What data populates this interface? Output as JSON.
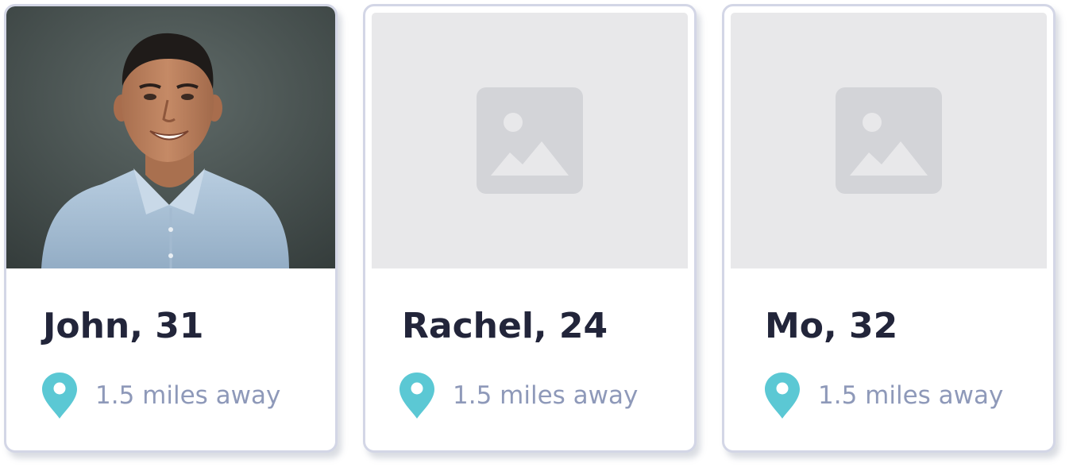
{
  "colors": {
    "accent_pin": "#5bc8d4",
    "name_text": "#22253a",
    "distance_text": "#8e99b9",
    "card_border": "#d3d6e6",
    "placeholder_bg": "#e8e8ea",
    "placeholder_icon": "#d3d4d8"
  },
  "profiles": [
    {
      "name_age": "John, 31",
      "distance": "1.5 miles away",
      "photo": "portrait-photo",
      "icon": "location-pin-icon"
    },
    {
      "name_age": "Rachel, 24",
      "distance": "1.5 miles away",
      "photo": "image-placeholder-icon",
      "icon": "location-pin-icon"
    },
    {
      "name_age": "Mo, 32",
      "distance": "1.5 miles away",
      "photo": "image-placeholder-icon",
      "icon": "location-pin-icon"
    }
  ]
}
